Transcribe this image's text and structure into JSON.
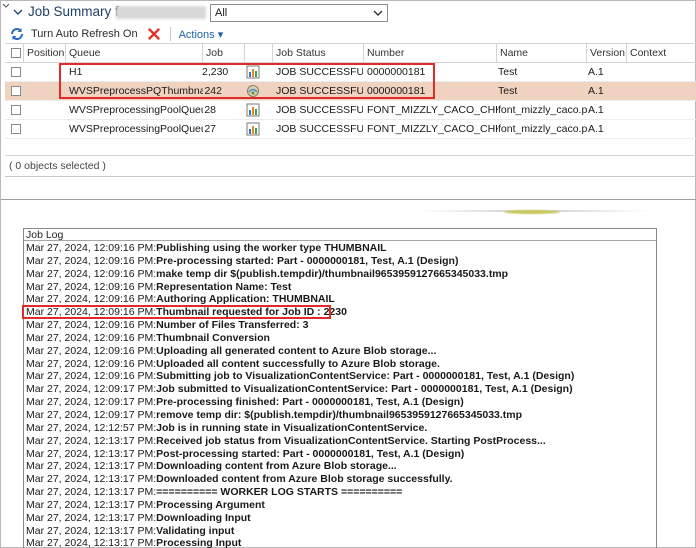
{
  "header": {
    "title": "Job Summary for",
    "filter_value": "All"
  },
  "toolbar": {
    "refresh_label": "Turn Auto Refresh On",
    "actions_label": "Actions",
    "actions_arrow": "▾"
  },
  "grid": {
    "columns": [
      "Position",
      "Queue",
      "Job",
      "",
      "Job Status",
      "Number",
      "Name",
      "Version",
      "Context"
    ],
    "rows": [
      {
        "queue": "H1",
        "job": "2,230",
        "icon": "publish-icon",
        "status": "JOB SUCCESSFUL",
        "number": "0000000181",
        "name": "Test",
        "version": "A.1",
        "context": ""
      },
      {
        "queue": "WVSPreprocessPQThumbnailH",
        "job": "242",
        "icon": "thumbnail-icon",
        "status": "JOB SUCCESSFUL",
        "number": "0000000181",
        "name": "Test",
        "version": "A.1",
        "context": ""
      },
      {
        "queue": "WVSPreprocessingPoolQueueL",
        "job": "28",
        "icon": "publish-icon",
        "status": "JOB SUCCESSFUL",
        "number": "FONT_MIZZLY_CACO_CHK.PRT",
        "name": "font_mizzly_caco.prt",
        "version": "A.1",
        "context": ""
      },
      {
        "queue": "WVSPreprocessingPoolQueueL",
        "job": "27",
        "icon": "publish-icon",
        "status": "JOB SUCCESSFUL",
        "number": "FONT_MIZZLY_CACO_CHK.PRT",
        "name": "font_mizzly_caco.prt",
        "version": "A.1",
        "context": ""
      }
    ],
    "footer": "( 0 objects selected )"
  },
  "job_log": {
    "title": "Job Log",
    "lines": [
      {
        "ts": "Mar 27, 2024, 12:09:16 PM:",
        "msg": "Publishing using the worker type THUMBNAIL"
      },
      {
        "ts": "Mar 27, 2024, 12:09:16 PM:",
        "msg": "Pre-processing started: Part - 0000000181, Test, A.1 (Design)"
      },
      {
        "ts": "Mar 27, 2024, 12:09:16 PM:",
        "msg": "make temp dir $(publish.tempdir)/thumbnail9653959127665345033.tmp"
      },
      {
        "ts": "Mar 27, 2024, 12:09:16 PM:",
        "msg": "Representation Name: Test"
      },
      {
        "ts": "Mar 27, 2024, 12:09:16 PM:",
        "msg": "Authoring Application: THUMBNAIL"
      },
      {
        "ts": "Mar 27, 2024, 12:09:16 PM:",
        "msg": "Thumbnail requested for Job ID : 2230"
      },
      {
        "ts": "Mar 27, 2024, 12:09:16 PM:",
        "msg": "Number of Files Transferred: 3"
      },
      {
        "ts": "Mar 27, 2024, 12:09:16 PM:",
        "msg": "Thumbnail Conversion"
      },
      {
        "ts": "Mar 27, 2024, 12:09:16 PM:",
        "msg": "Uploading all generated content to Azure Blob storage..."
      },
      {
        "ts": "Mar 27, 2024, 12:09:16 PM:",
        "msg": "Uploaded all content successfully to Azure Blob storage."
      },
      {
        "ts": "Mar 27, 2024, 12:09:16 PM:",
        "msg": "Submitting job to VisualizationContentService: Part - 0000000181, Test, A.1 (Design)"
      },
      {
        "ts": "Mar 27, 2024, 12:09:17 PM:",
        "msg": "Job submitted to VisualizationContentService: Part - 0000000181, Test, A.1 (Design)"
      },
      {
        "ts": "Mar 27, 2024, 12:09:17 PM:",
        "msg": "Pre-processing finished: Part - 0000000181, Test, A.1 (Design)"
      },
      {
        "ts": "Mar 27, 2024, 12:09:17 PM:",
        "msg": "remove temp dir: $(publish.tempdir)/thumbnail9653959127665345033.tmp"
      },
      {
        "ts": "Mar 27, 2024, 12:12:57 PM:",
        "msg": "Job is in running state in VisualizationContentService."
      },
      {
        "ts": "Mar 27, 2024, 12:13:17 PM:",
        "msg": "Received job status from VisualizationContentService. Starting PostProcess..."
      },
      {
        "ts": "Mar 27, 2024, 12:13:17 PM:",
        "msg": "Post-processing started: Part - 0000000181, Test, A.1 (Design)"
      },
      {
        "ts": "Mar 27, 2024, 12:13:17 PM:",
        "msg": "Downloading content from Azure Blob storage..."
      },
      {
        "ts": "Mar 27, 2024, 12:13:17 PM:",
        "msg": "Downloaded content from Azure Blob storage successfully."
      },
      {
        "ts": "Mar 27, 2024, 12:13:17 PM:",
        "msg": "========== WORKER LOG STARTS =========="
      },
      {
        "ts": "Mar 27, 2024, 12:13:17 PM:",
        "msg": "Processing Argument"
      },
      {
        "ts": "Mar 27, 2024, 12:13:17 PM:",
        "msg": "Downloading Input"
      },
      {
        "ts": "Mar 27, 2024, 12:13:17 PM:",
        "msg": "Validating input"
      },
      {
        "ts": "Mar 27, 2024, 12:13:17 PM:",
        "msg": "Processing Input"
      }
    ]
  },
  "colors": {
    "title_blue": "#1f3f66",
    "link_blue": "#2163a8",
    "selected_row": "#efd2c0",
    "annotation_red": "#e02b2b"
  }
}
